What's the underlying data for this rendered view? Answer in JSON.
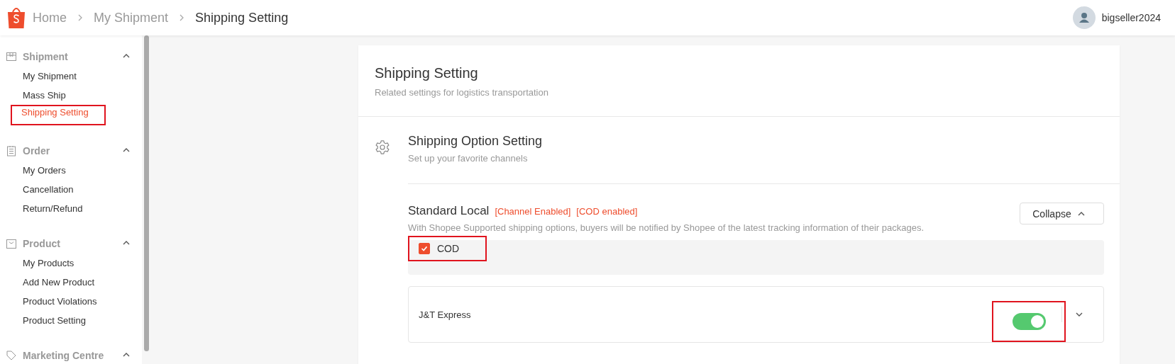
{
  "breadcrumb": [
    {
      "label": "Home",
      "current": false
    },
    {
      "label": "My Shipment",
      "current": false
    },
    {
      "label": "Shipping Setting",
      "current": true
    }
  ],
  "user": {
    "name": "bigseller2024"
  },
  "sidebar": {
    "sections": [
      {
        "title": "Shipment",
        "expanded": true,
        "items": [
          {
            "label": "My Shipment",
            "selected": false,
            "highlighted": false
          },
          {
            "label": "Mass Ship",
            "selected": false,
            "highlighted": false
          },
          {
            "label": "Shipping Setting",
            "selected": true,
            "highlighted": true
          }
        ]
      },
      {
        "title": "Order",
        "expanded": true,
        "items": [
          {
            "label": "My Orders",
            "selected": false,
            "highlighted": false
          },
          {
            "label": "Cancellation",
            "selected": false,
            "highlighted": false
          },
          {
            "label": "Return/Refund",
            "selected": false,
            "highlighted": false
          }
        ]
      },
      {
        "title": "Product",
        "expanded": true,
        "items": [
          {
            "label": "My Products",
            "selected": false,
            "highlighted": false
          },
          {
            "label": "Add New Product",
            "selected": false,
            "highlighted": false
          },
          {
            "label": "Product Violations",
            "selected": false,
            "highlighted": false
          },
          {
            "label": "Product Setting",
            "selected": false,
            "highlighted": false
          }
        ]
      },
      {
        "title": "Marketing Centre",
        "expanded": true
      }
    ]
  },
  "page": {
    "title": "Shipping Setting",
    "subtitle": "Related settings for logistics transportation"
  },
  "section": {
    "title": "Shipping Option Setting",
    "subtitle": "Set up your favorite channels"
  },
  "channel_group": {
    "title": "Standard Local",
    "tags": [
      "[Channel Enabled]",
      "[COD enabled]"
    ],
    "description": "With Shopee Supported shipping options, buyers will be notified by Shopee of the latest tracking information of their packages.",
    "collapse_button": "Collapse",
    "expanded": true,
    "cod": {
      "label": "COD",
      "checked": true,
      "highlighted": true
    },
    "channels": [
      {
        "name": "J&T Express",
        "on": true,
        "highlighted": true,
        "expanded": false
      }
    ]
  }
}
